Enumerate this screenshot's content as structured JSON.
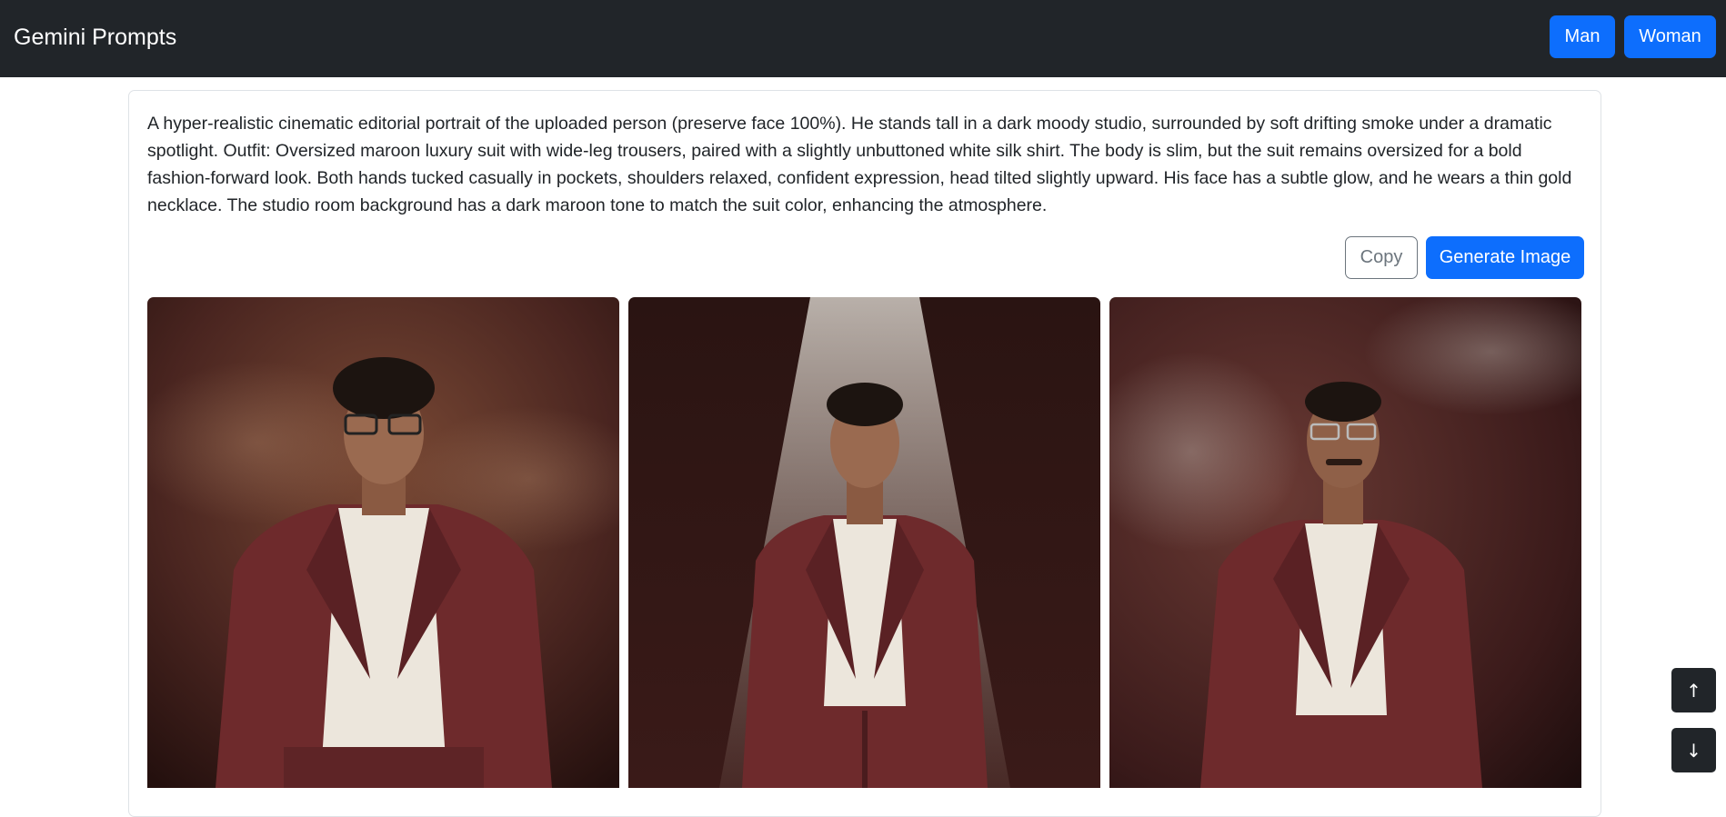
{
  "navbar": {
    "brand": "Gemini Prompts",
    "buttons": {
      "man": "Man",
      "woman": "Woman"
    }
  },
  "prompt": {
    "text": "A hyper-realistic cinematic editorial portrait of the uploaded person (preserve face 100%). He stands tall in a dark moody studio, surrounded by soft drifting smoke under a dramatic spotlight. Outfit: Oversized maroon luxury suit with wide-leg trousers, paired with a slightly unbuttoned white silk shirt. The body is slim, but the suit remains oversized for a bold fashion-forward look. Both hands tucked casually in pockets, shoulders relaxed, confident expression, head tilted slightly upward. His face has a subtle glow, and he wears a thin gold necklace. The studio room background has a dark maroon tone to match the suit color, enhancing the atmosphere.",
    "copy_label": "Copy",
    "generate_label": "Generate Image"
  },
  "images": [
    {
      "subject": "man with curly hair and glasses in maroon suit, warm smoky background"
    },
    {
      "subject": "young man in maroon suit under overhead spotlight"
    },
    {
      "subject": "older man with glasses and mustache in maroon suit, smoky background"
    }
  ],
  "scroll": {
    "up": "↑",
    "down": "↓"
  },
  "colors": {
    "navbar_bg": "#212529",
    "primary": "#0d6efd",
    "secondary": "#6c757d",
    "suit": "#6e2a2c",
    "shirt": "#ece6dc"
  },
  "icons": {
    "scroll_up": "arrow-up-icon",
    "scroll_down": "arrow-down-icon"
  }
}
